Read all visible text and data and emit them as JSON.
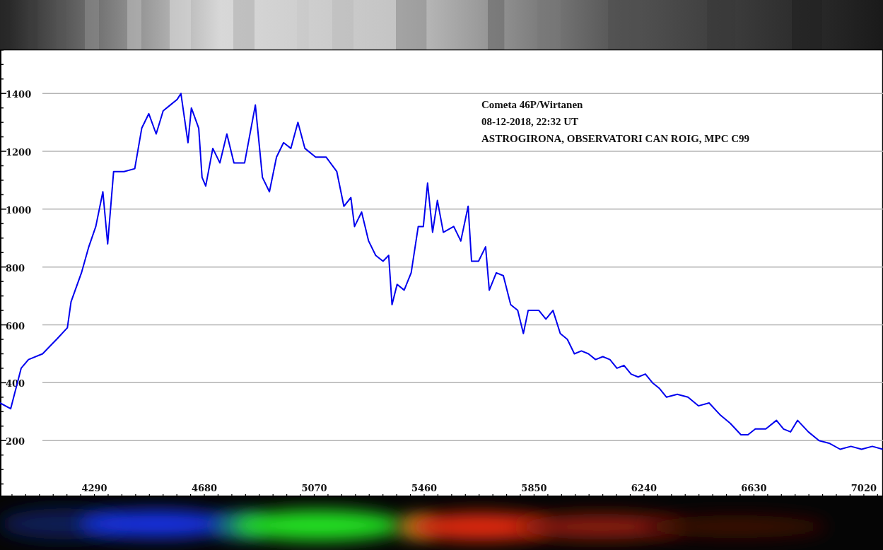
{
  "chart": {
    "chart_data": {
      "type": "line",
      "grid": true,
      "xlim": [
        3955,
        7088
      ],
      "ylim": [
        5,
        1552
      ],
      "xticks": [
        4290,
        4680,
        5070,
        5460,
        5850,
        6240,
        6630,
        7020
      ],
      "yticks": [
        200,
        400,
        600,
        800,
        1000,
        1200,
        1400
      ],
      "annotations": [
        "Cometa 46P/Wirtanen",
        "08-12-2018, 22:32 UT",
        "ASTROGIRONA, OBSERVATORI CAN ROIG, MPC C99"
      ],
      "x": [
        3955,
        3993,
        4030,
        4056,
        4106,
        4156,
        4194,
        4207,
        4244,
        4270,
        4295,
        4320,
        4337,
        4358,
        4395,
        4433,
        4458,
        4483,
        4509,
        4534,
        4559,
        4584,
        4597,
        4622,
        4634,
        4660,
        4672,
        4685,
        4710,
        4735,
        4760,
        4785,
        4823,
        4861,
        4886,
        4911,
        4936,
        4961,
        4987,
        5012,
        5037,
        5075,
        5112,
        5150,
        5175,
        5200,
        5213,
        5238,
        5263,
        5288,
        5314,
        5334,
        5346,
        5364,
        5389,
        5414,
        5439,
        5457,
        5472,
        5490,
        5507,
        5528,
        5565,
        5590,
        5616,
        5628,
        5653,
        5678,
        5691,
        5716,
        5741,
        5767,
        5792,
        5812,
        5829,
        5867,
        5892,
        5917,
        5943,
        5968,
        5993,
        6018,
        6043,
        6068,
        6094,
        6119,
        6144,
        6169,
        6194,
        6219,
        6245,
        6270,
        6295,
        6320,
        6358,
        6396,
        6433,
        6471,
        6509,
        6546,
        6584,
        6609,
        6635,
        6672,
        6710,
        6735,
        6760,
        6785,
        6823,
        6861,
        6899,
        6936,
        6974,
        7012,
        7050,
        7087
      ],
      "series": [
        {
          "color": "#0000ee",
          "values": [
            330,
            310,
            450,
            480,
            500,
            550,
            590,
            680,
            780,
            870,
            940,
            1060,
            880,
            1130,
            1130,
            1140,
            1280,
            1330,
            1260,
            1340,
            1360,
            1380,
            1400,
            1230,
            1350,
            1280,
            1110,
            1080,
            1210,
            1160,
            1260,
            1160,
            1160,
            1360,
            1110,
            1060,
            1180,
            1230,
            1210,
            1300,
            1210,
            1180,
            1180,
            1130,
            1010,
            1040,
            940,
            990,
            890,
            840,
            820,
            840,
            670,
            740,
            720,
            780,
            940,
            940,
            1090,
            920,
            1030,
            920,
            940,
            890,
            1010,
            820,
            820,
            870,
            720,
            780,
            770,
            670,
            650,
            570,
            650,
            650,
            620,
            650,
            570,
            550,
            500,
            510,
            500,
            480,
            490,
            480,
            450,
            460,
            430,
            420,
            430,
            400,
            380,
            350,
            360,
            350,
            320,
            330,
            290,
            260,
            220,
            220,
            240,
            240,
            270,
            240,
            230,
            270,
            230,
            200,
            190,
            170,
            180,
            170,
            180,
            170
          ]
        }
      ]
    }
  }
}
